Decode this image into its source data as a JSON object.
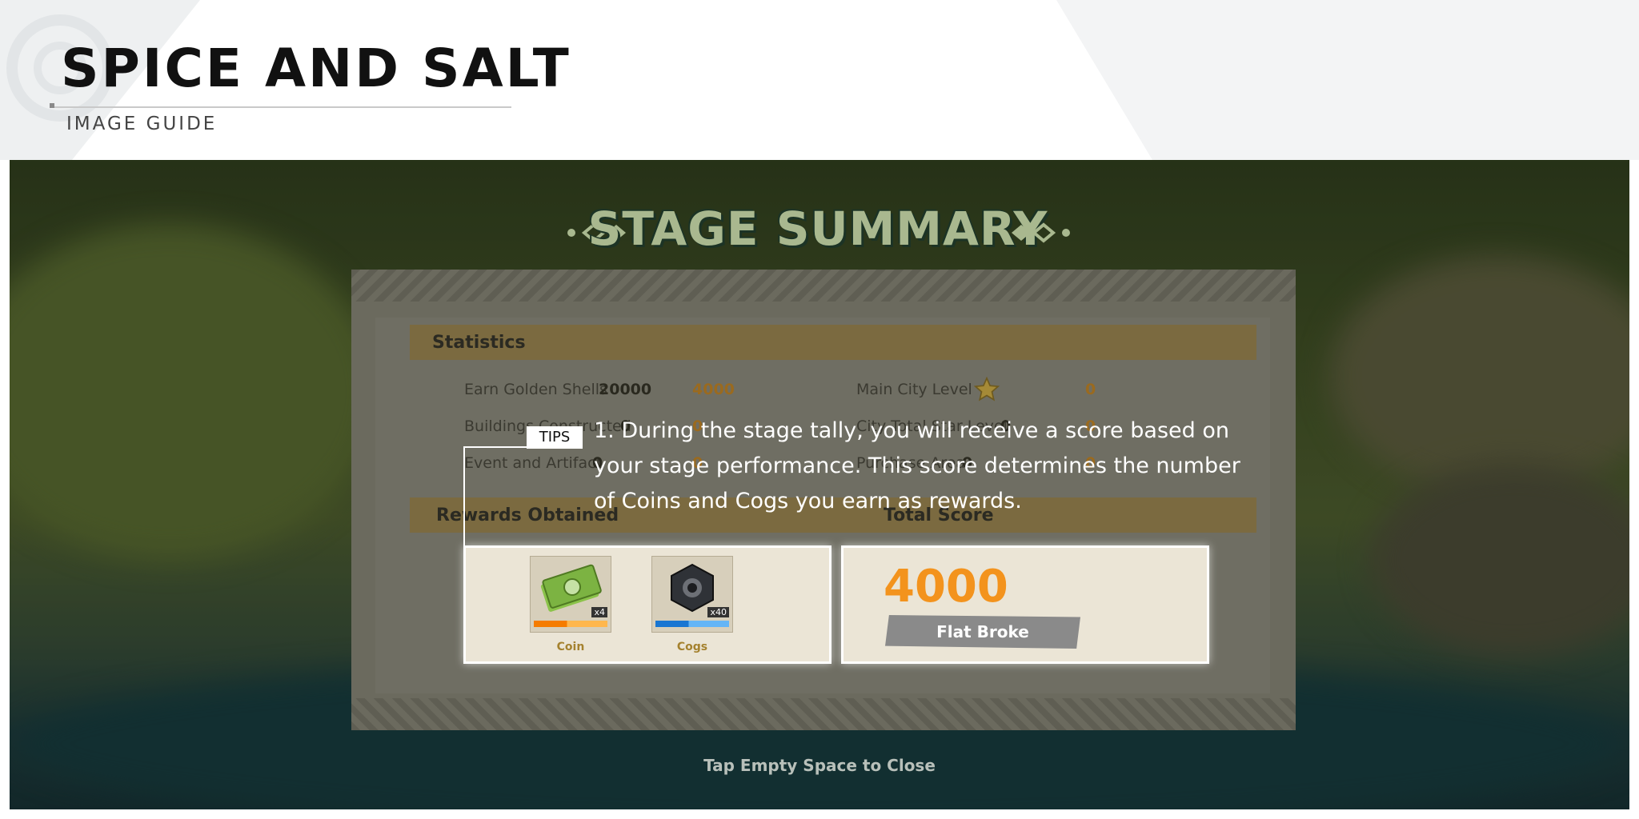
{
  "header": {
    "title": "SPICE AND SALT",
    "subtitle": "IMAGE GUIDE"
  },
  "stage": {
    "title": "STAGE SUMMARY",
    "statistics": {
      "label": "Statistics",
      "rows": [
        {
          "label": "Earn Golden Shells",
          "value": "20000",
          "score": "4000"
        },
        {
          "label": "Buildings Constructed",
          "value": "0",
          "score": "0"
        },
        {
          "label": "Event and Artifact",
          "value": "0",
          "score": "0"
        }
      ],
      "rows_right": [
        {
          "label": "Main City Level",
          "value": "",
          "score": "0"
        },
        {
          "label": "City Total Star Level",
          "value": "0",
          "score": "0"
        },
        {
          "label": "Purchase Area",
          "value": "0",
          "score": "0"
        }
      ]
    },
    "rewards": {
      "label": "Rewards Obtained",
      "items": [
        {
          "name": "Coin",
          "count": "x4",
          "icon": "cash-icon"
        },
        {
          "name": "Cogs",
          "count": "x40",
          "icon": "cog-nut-icon"
        }
      ]
    },
    "total": {
      "label": "Total Score",
      "value": "4000",
      "rank": "Flat Broke"
    },
    "tips": {
      "tag": "TIPS",
      "text": "1. During the stage tally, you will receive a score based on your stage performance. This score determines the number of Coins and Cogs you earn as rewards."
    },
    "close_hint": "Tap Empty Space to Close"
  },
  "colors": {
    "accent_orange": "#f3931d",
    "title_green": "#a9b88f",
    "card_bg": "#ebe5d6",
    "coin_name": "#a5822f"
  }
}
